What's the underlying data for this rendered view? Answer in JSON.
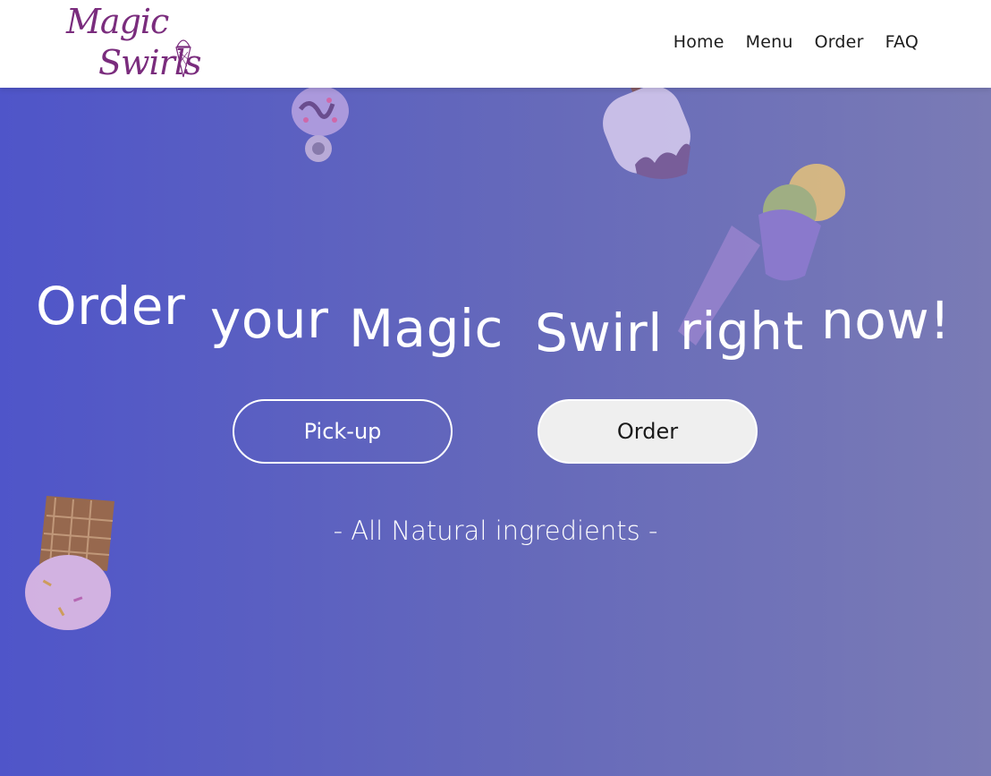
{
  "brand": {
    "logo_line1": "Magic",
    "logo_line2": "Swirls",
    "logo_color": "#7a2c7d"
  },
  "nav": {
    "items": [
      {
        "label": "Home"
      },
      {
        "label": "Menu"
      },
      {
        "label": "Order"
      },
      {
        "label": "FAQ"
      }
    ]
  },
  "hero": {
    "headline_words": [
      "Order",
      "your",
      "Magic",
      "Swirl",
      "right",
      "now!"
    ],
    "buttons": {
      "pickup_label": "Pick-up",
      "order_label": "Order"
    },
    "tagline": "- All Natural ingredients -",
    "gradient_colors": [
      "#4f55c9",
      "#7a7bb5"
    ],
    "decorations": [
      "donut-pop-icon",
      "popsicle-icon",
      "ice-cream-cup-icon",
      "waffle-cone-icon"
    ]
  }
}
